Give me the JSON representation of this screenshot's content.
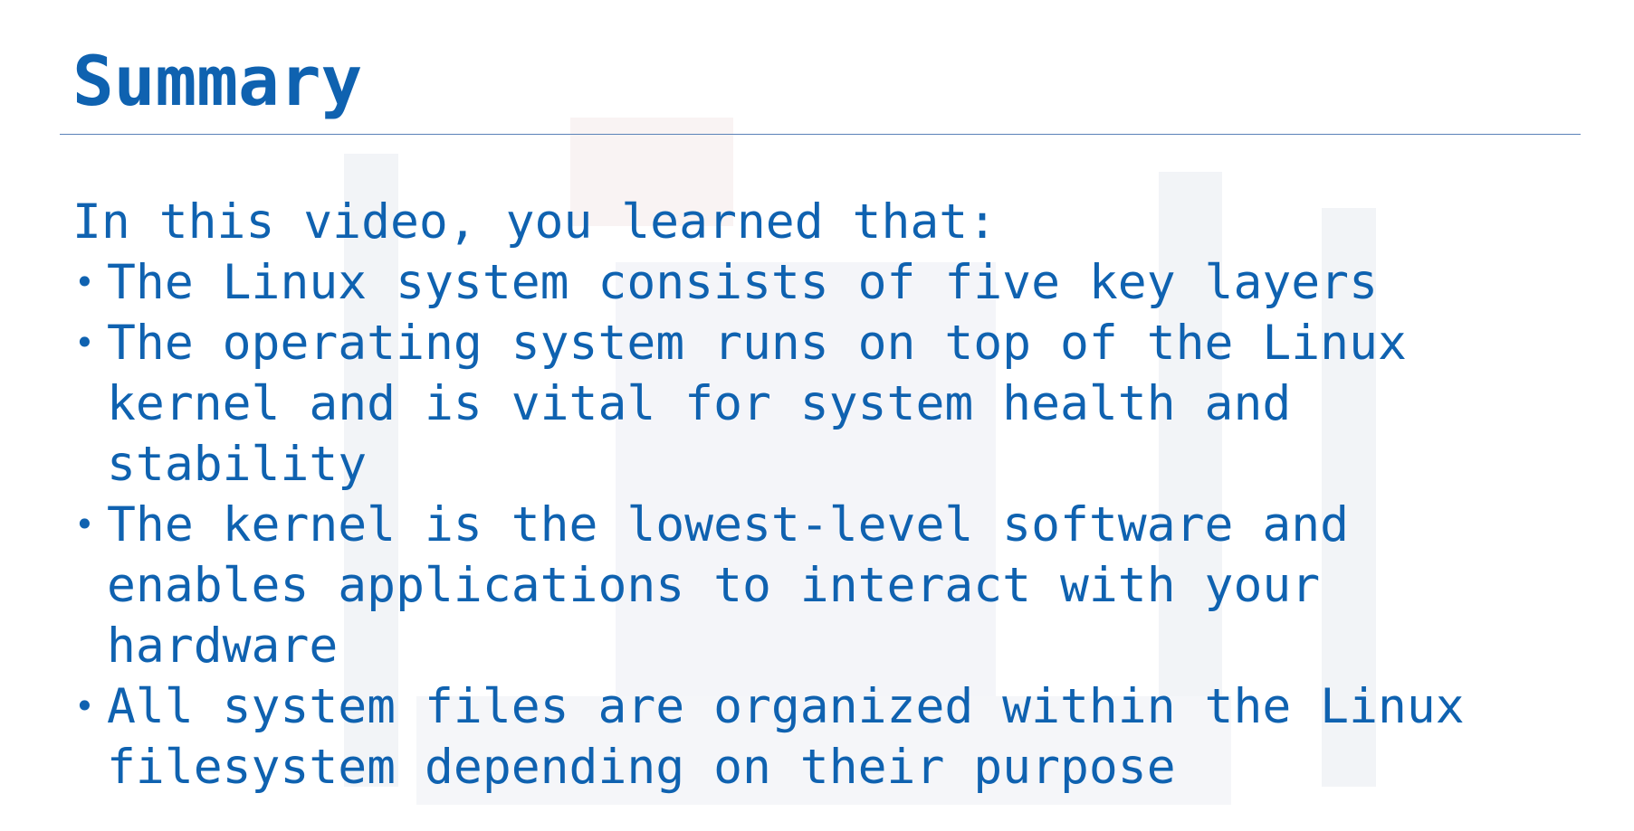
{
  "slide": {
    "title": "Summary",
    "intro": "In this video, you learned that:",
    "bullets": [
      {
        "lines": [
          "The Linux system consists of five key layers"
        ]
      },
      {
        "lines": [
          "The operating system runs on top of the Linux",
          "kernel and is vital for system health and",
          "stability"
        ]
      },
      {
        "lines": [
          "The kernel is the lowest-level software and",
          "enables applications to interact with your",
          "hardware"
        ]
      },
      {
        "lines": [
          "All system files are organized within the Linux",
          "filesystem depending on their purpose"
        ]
      }
    ]
  },
  "colors": {
    "text": "#0f62b0",
    "divider": "#5b82b8",
    "background": "#ffffff"
  }
}
